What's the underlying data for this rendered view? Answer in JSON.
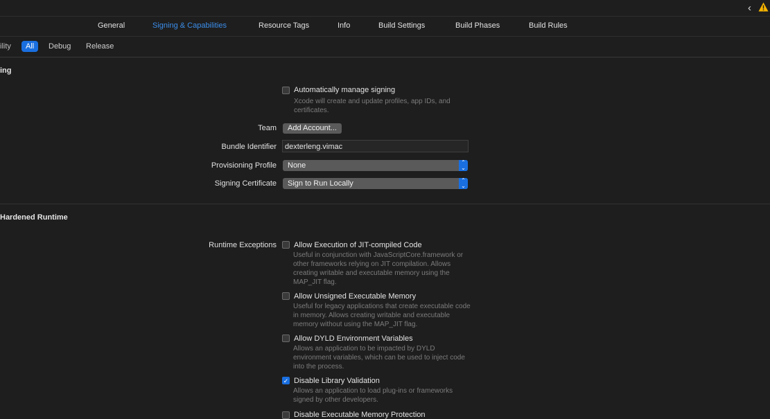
{
  "tabs": [
    "General",
    "Signing & Capabilities",
    "Resource Tags",
    "Info",
    "Build Settings",
    "Build Phases",
    "Build Rules"
  ],
  "filter": {
    "partial_label": "ility",
    "options": [
      "All",
      "Debug",
      "Release"
    ]
  },
  "signing": {
    "title": "ing",
    "auto_manage_label": "Automatically manage signing",
    "auto_manage_desc": "Xcode will create and update profiles, app IDs, and certificates.",
    "team_label": "Team",
    "team_button": "Add Account...",
    "bundle_label": "Bundle Identifier",
    "bundle_value": "dexterleng.vimac",
    "prov_label": "Provisioning Profile",
    "prov_value": "None",
    "cert_label": "Signing Certificate",
    "cert_value": "Sign to Run Locally"
  },
  "hardened": {
    "title": "Hardened Runtime",
    "exceptions_label": "Runtime Exceptions",
    "options": [
      {
        "title": "Allow Execution of JIT-compiled Code",
        "desc": "Useful in conjunction with JavaScriptCore.framework or other frameworks relying on JIT compilation. Allows creating writable and executable memory using the MAP_JIT flag.",
        "checked": false
      },
      {
        "title": "Allow Unsigned Executable Memory",
        "desc": "Useful for legacy applications that create executable code in memory. Allows creating writable and executable memory without using the MAP_JIT flag.",
        "checked": false
      },
      {
        "title": "Allow DYLD Environment Variables",
        "desc": "Allows an application to be impacted by DYLD environment variables, which can be used to inject code into the process.",
        "checked": false
      },
      {
        "title": "Disable Library Validation",
        "desc": "Allows an application to load plug-ins or frameworks signed by other developers.",
        "checked": true
      },
      {
        "title": "Disable Executable Memory Protection",
        "desc": "",
        "checked": false
      }
    ]
  },
  "colors": {
    "accent": "#1a6fe0",
    "active_tab": "#3b8eea",
    "background": "#1e1e1e",
    "warning": "#f5b400"
  },
  "icons": {
    "back": "chevron-left-icon",
    "warning": "warning-icon",
    "checkbox": "checkmark-icon",
    "stepper": "up-down-chevron-icon"
  }
}
